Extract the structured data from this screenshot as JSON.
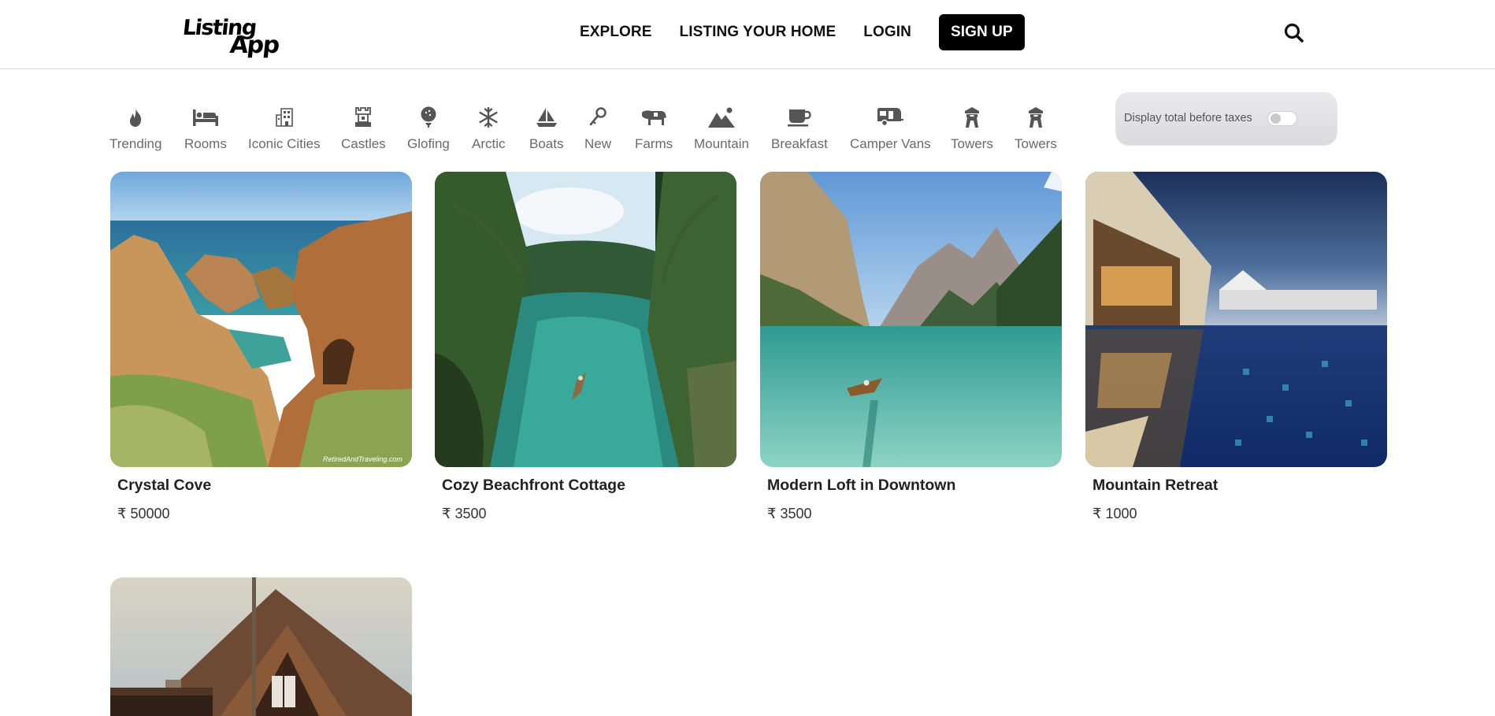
{
  "header": {
    "logo_line1": "Listing",
    "logo_line2": "App",
    "nav": {
      "explore": "EXPLORE",
      "listing_your_home": "LISTING YOUR HOME",
      "login": "LOGIN",
      "signup": "SIGN UP"
    },
    "search_icon": "search-icon"
  },
  "filters": [
    {
      "label": "Trending",
      "icon": "fire-icon"
    },
    {
      "label": "Rooms",
      "icon": "bed-icon"
    },
    {
      "label": "Iconic Cities",
      "icon": "building-icon"
    },
    {
      "label": "Castles",
      "icon": "castle-icon"
    },
    {
      "label": "Glofing",
      "icon": "golf-icon"
    },
    {
      "label": "Arctic",
      "icon": "snowflake-icon"
    },
    {
      "label": "Boats",
      "icon": "sailboat-icon"
    },
    {
      "label": "New",
      "icon": "key-icon"
    },
    {
      "label": "Farms",
      "icon": "cow-icon"
    },
    {
      "label": "Mountain",
      "icon": "mountain-icon"
    },
    {
      "label": "Breakfast",
      "icon": "mug-icon"
    },
    {
      "label": "Camper Vans",
      "icon": "caravan-icon"
    },
    {
      "label": "Towers",
      "icon": "tower-icon"
    },
    {
      "label": "Towers",
      "icon": "tower-icon"
    }
  ],
  "tax_toggle": {
    "label": "Display total before taxes",
    "enabled": false
  },
  "listings": [
    {
      "title": "Crystal Cove",
      "price": "₹ 50000",
      "image": "coastal-cliffs-photo",
      "watermark": "RetiredAndTraveling.com"
    },
    {
      "title": "Cozy Beachfront Cottage",
      "price": "₹ 3500",
      "image": "palm-river-boat-photo"
    },
    {
      "title": "Modern Loft in Downtown",
      "price": "₹ 3500",
      "image": "mountain-lake-boat-photo"
    },
    {
      "title": "Mountain Retreat",
      "price": "₹ 1000",
      "image": "resort-pool-night-photo"
    },
    {
      "title": "",
      "price": "",
      "image": "wooden-lodge-photo"
    }
  ]
}
